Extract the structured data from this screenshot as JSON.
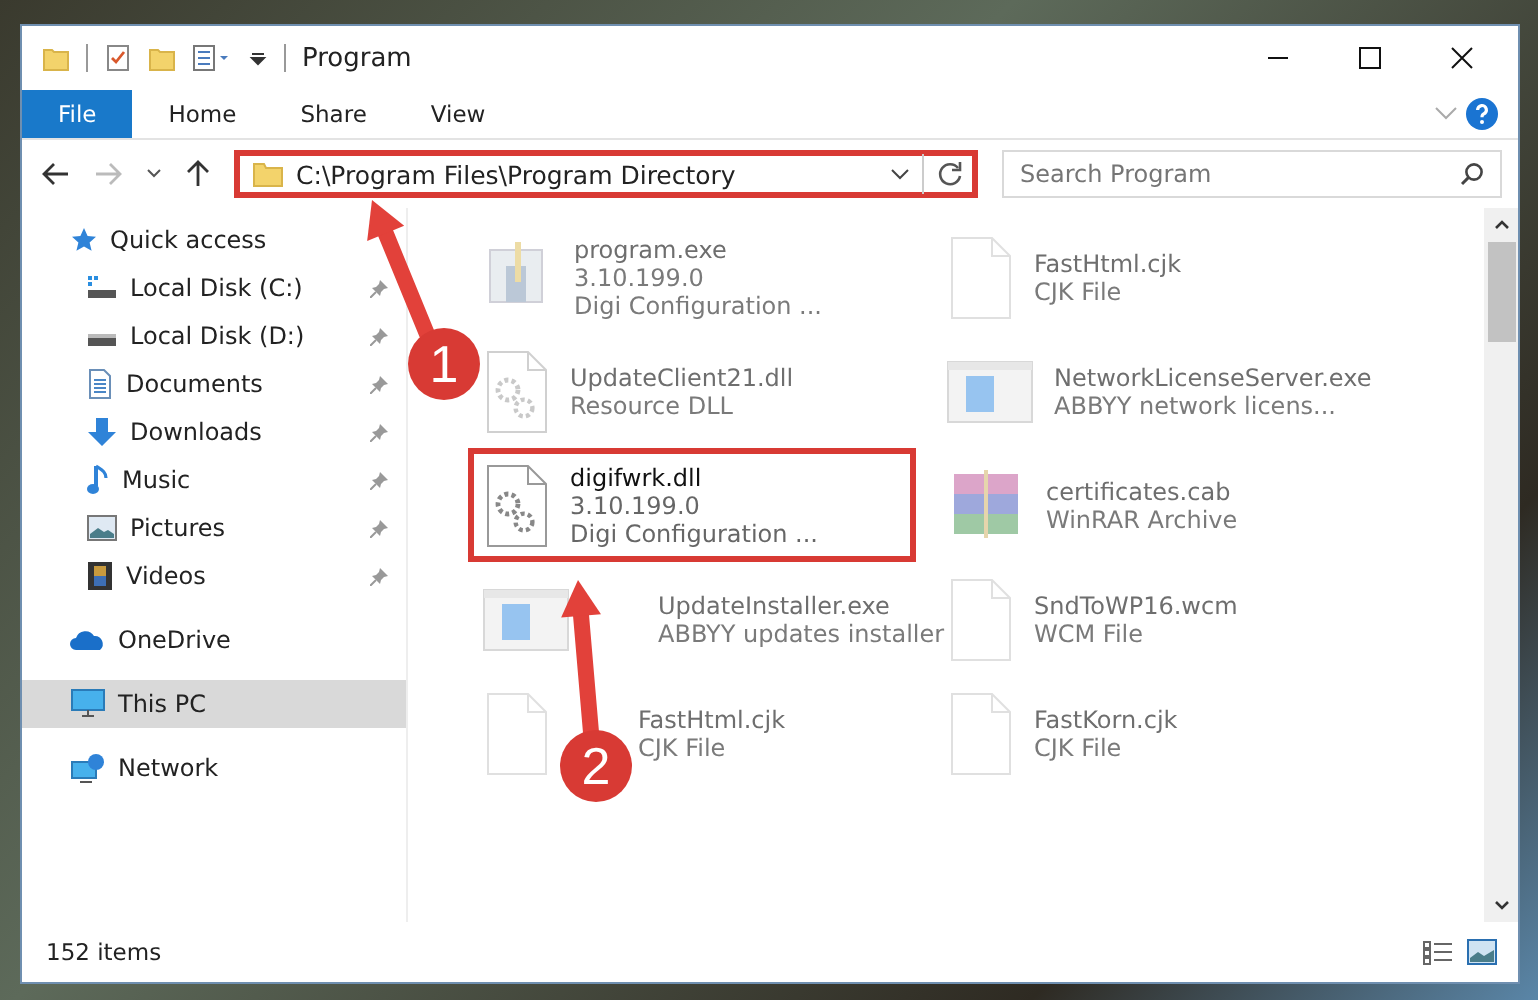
{
  "window": {
    "title": "Program"
  },
  "ribbon_tabs": [
    {
      "label": "File",
      "selected": true
    },
    {
      "label": "Home",
      "selected": false
    },
    {
      "label": "Share",
      "selected": false
    },
    {
      "label": "View",
      "selected": false
    }
  ],
  "address_bar": {
    "path": "C:\\Program Files\\Program Directory",
    "highlighted": true
  },
  "search": {
    "placeholder": "Search Program"
  },
  "sidebar": {
    "items": [
      {
        "label": "Quick access",
        "kind": "star",
        "selected": false,
        "children": [
          {
            "label": "Local Disk (C:)",
            "kind": "drive-c",
            "pinned": true,
            "selected": false
          },
          {
            "label": "Local Disk (D:)",
            "kind": "drive",
            "pinned": true,
            "selected": false
          },
          {
            "label": "Documents",
            "kind": "documents",
            "pinned": true,
            "selected": false
          },
          {
            "label": "Downloads",
            "kind": "downloads",
            "pinned": true,
            "selected": false
          },
          {
            "label": "Music",
            "kind": "music",
            "pinned": true,
            "selected": false
          },
          {
            "label": "Pictures",
            "kind": "pictures",
            "pinned": true,
            "selected": false
          },
          {
            "label": "Videos",
            "kind": "videos",
            "pinned": true,
            "selected": false
          }
        ]
      },
      {
        "label": "OneDrive",
        "kind": "cloud",
        "selected": false
      },
      {
        "label": "This PC",
        "kind": "pc",
        "selected": true
      },
      {
        "label": "Network",
        "kind": "network",
        "selected": false
      }
    ]
  },
  "files": [
    {
      "name": "program.exe",
      "details": [
        "3.10.199.0",
        "Digi Configuration ..."
      ],
      "kind": "setup",
      "dimmed": true,
      "highlighted": false
    },
    {
      "name": "FastHtml.cjk",
      "details": [
        "CJK File"
      ],
      "kind": "blank",
      "dimmed": true,
      "highlighted": false
    },
    {
      "name": "UpdateClient21.dll",
      "details": [
        "Resource DLL"
      ],
      "kind": "gear",
      "dimmed": true,
      "highlighted": false
    },
    {
      "name": "NetworkLicenseServer.exe",
      "details": [
        "ABBYY network licens..."
      ],
      "kind": "app",
      "dimmed": true,
      "highlighted": false
    },
    {
      "name": "digifwrk.dll",
      "details": [
        "3.10.199.0",
        "Digi Configuration ..."
      ],
      "kind": "gear",
      "dimmed": false,
      "highlighted": true
    },
    {
      "name": "certificates.cab",
      "details": [
        "WinRAR Archive"
      ],
      "kind": "archive",
      "dimmed": true,
      "highlighted": false
    },
    {
      "name": "UpdateInstaller.exe",
      "details": [
        "ABBYY updates installer"
      ],
      "kind": "app",
      "dimmed": true,
      "highlighted": false
    },
    {
      "name": "SndToWP16.wcm",
      "details": [
        "WCM File"
      ],
      "kind": "blank",
      "dimmed": true,
      "highlighted": false
    },
    {
      "name": "FastHtml.cjk",
      "details": [
        "CJK File"
      ],
      "kind": "blank",
      "dimmed": true,
      "highlighted": false
    },
    {
      "name": "FastKorn.cjk",
      "details": [
        "CJK File"
      ],
      "kind": "blank",
      "dimmed": true,
      "highlighted": false
    }
  ],
  "status_bar": {
    "item_count": "152 items"
  },
  "annotations": [
    {
      "number": "1"
    },
    {
      "number": "2"
    }
  ]
}
